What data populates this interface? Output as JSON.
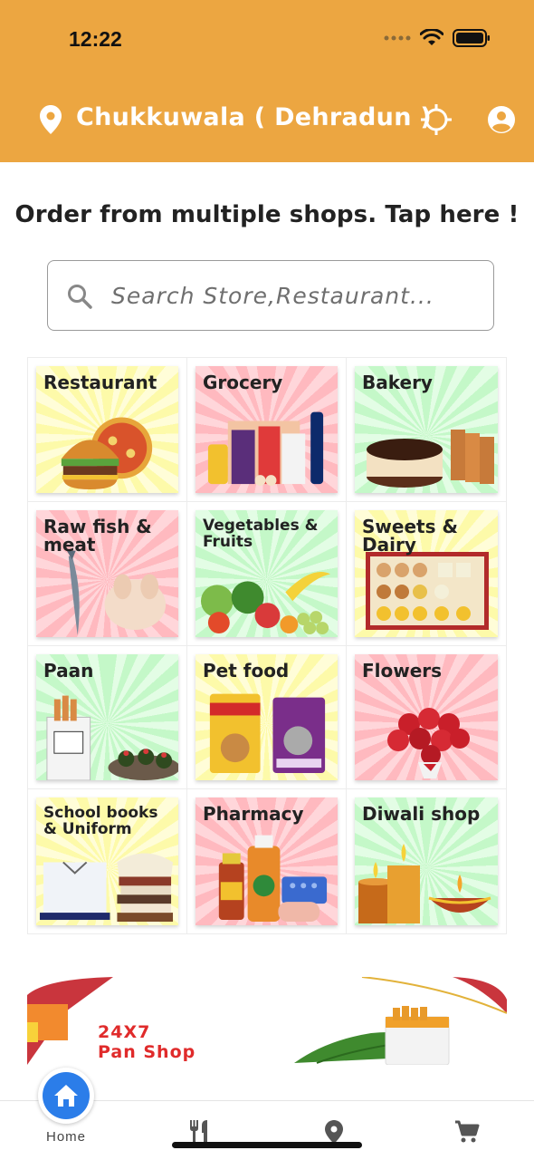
{
  "status_bar": {
    "time": "12:22"
  },
  "header": {
    "location": "Chukkuwala ( Dehradun )"
  },
  "headline": "Order from multiple shops. Tap here !",
  "search": {
    "placeholder": "Search Store,Restaurant..."
  },
  "categories": [
    {
      "label": "Restaurant",
      "bg": "yellow",
      "icon": "burger-pizza-image"
    },
    {
      "label": "Grocery",
      "bg": "pink",
      "icon": "grocery-bags-image"
    },
    {
      "label": "Bakery",
      "bg": "green",
      "icon": "cake-toast-image"
    },
    {
      "label": "Raw fish & meat",
      "bg": "pink",
      "icon": "fish-chicken-image"
    },
    {
      "label": "Vegetables & Fruits",
      "bg": "green",
      "icon": "vegetables-fruits-image"
    },
    {
      "label": "Sweets & Dairy",
      "bg": "yellow",
      "icon": "sweets-box-image"
    },
    {
      "label": "Paan",
      "bg": "green",
      "icon": "cigarettes-paan-image"
    },
    {
      "label": "Pet food",
      "bg": "yellow",
      "icon": "pet-food-bags-image"
    },
    {
      "label": "Flowers",
      "bg": "pink",
      "icon": "rose-bouquet-image"
    },
    {
      "label": "School books & Uniform",
      "bg": "yellow",
      "icon": "books-shirt-image"
    },
    {
      "label": "Pharmacy",
      "bg": "pink",
      "icon": "medicine-bottles-image"
    },
    {
      "label": "Diwali shop",
      "bg": "green",
      "icon": "diya-candles-image"
    }
  ],
  "banner": {
    "line1": "24X7",
    "line2": "Pan Shop"
  },
  "bottom_nav": {
    "home_label": "Home",
    "items": [
      "home-icon",
      "restaurant-icon",
      "location-icon",
      "cart-icon"
    ]
  },
  "colors": {
    "header": "#eca641",
    "home_button": "#2b7de9",
    "banner_red": "#e02b2b"
  }
}
